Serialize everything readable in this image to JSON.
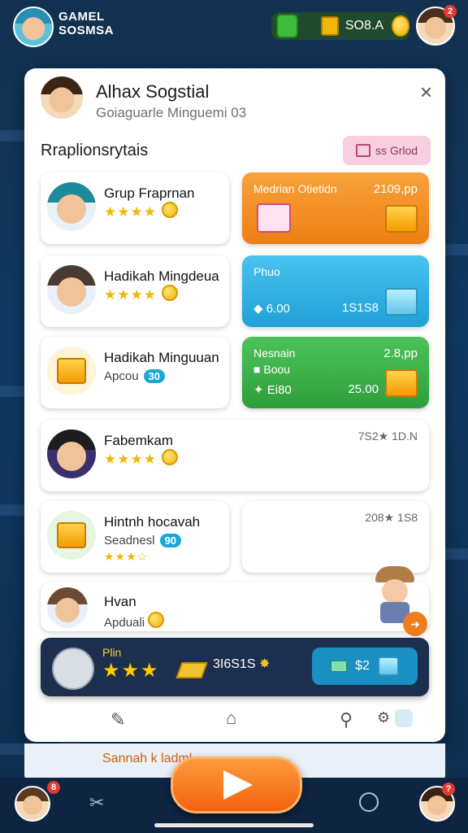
{
  "header": {
    "brand_line1": "GAMEL",
    "brand_line2": "SOSMSA",
    "currency_value": "SO8.A",
    "notification_badge": "2"
  },
  "modal": {
    "user_name": "Alhax Sogstial",
    "user_subtitle": "Goiaguarle Minguemi 03",
    "close_icon": "×",
    "section_title": "Rraplionsrytais",
    "share_button": "ss Grlod"
  },
  "entries": [
    {
      "name": "Grup Fraprnan",
      "stars": "★★★★",
      "sub": ""
    },
    {
      "name": "Hadikah Mingdeua",
      "stars": "★★★★",
      "sub": ""
    },
    {
      "name": "Hadikah Minguuan",
      "sub": "Apcou",
      "level": "30"
    },
    {
      "name": "Fabemkam",
      "stars": "★★★★",
      "value": "7S2★ 1D.N"
    },
    {
      "name": "Hintnh hocavah",
      "sub": "Seadnesl",
      "level": "90",
      "stars": "★★★☆",
      "value": "208★ 1S8"
    },
    {
      "name": "Hvan",
      "sub": "Apduali"
    }
  ],
  "offers": [
    {
      "title": "Medrian Otietidn",
      "price": "2109,pp",
      "color": "#f28c1e"
    },
    {
      "title": "Phuo",
      "r1": "6.00",
      "r2": "1S1S8",
      "color": "#2ab0e0"
    },
    {
      "title": "Nesnain",
      "price": "2.8,pp",
      "r1": "Boou",
      "r1b": "Ei80",
      "r2": "25.00",
      "color": "#3cb34a"
    }
  ],
  "promo": {
    "label": "Plin",
    "stars": "★★★",
    "score": "3I6S1S",
    "buy_value": "$2"
  },
  "peek": {
    "title": "Sannah k ladml"
  },
  "bottom": {
    "left_badge": "8",
    "right_badge": "?"
  },
  "colors": {
    "accent": "#f28c1e",
    "blue": "#2ab0e0",
    "green": "#3cb34a",
    "star": "#f2b705"
  }
}
